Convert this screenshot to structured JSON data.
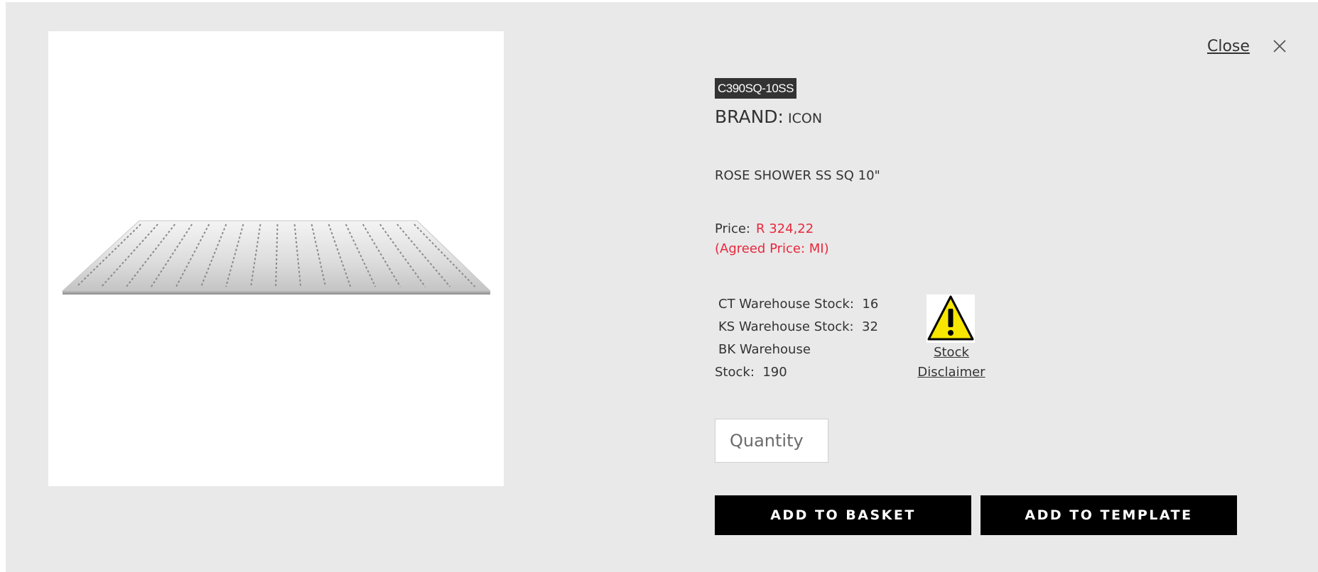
{
  "modal": {
    "close_label": "Close",
    "close_icon": "close-icon"
  },
  "product": {
    "image_alt": "shower-head-image",
    "sku": "C390SQ-10SS",
    "brand_label": "BRAND:",
    "brand_value": "ICON",
    "description": "ROSE SHOWER SS SQ 10\"",
    "price_label": "Price:",
    "price_value": "R 324,22",
    "agreed_price": "(Agreed Price: MI)",
    "stock": {
      "ct_label": "CT Warehouse Stock:",
      "ct_value": "16",
      "ks_label": "KS Warehouse Stock:",
      "ks_value": "32",
      "bk_label_line1": "BK Warehouse",
      "bk_label_line2": "Stock:",
      "bk_value": "190"
    },
    "disclaimer_line1": "Stock",
    "disclaimer_line2": "Disclaimer",
    "warning_icon": "warning-icon"
  },
  "form": {
    "quantity_placeholder": "Quantity",
    "quantity_value": ""
  },
  "actions": {
    "add_to_basket": "ADD TO BASKET",
    "add_to_template": "ADD TO TEMPLATE"
  },
  "colors": {
    "background": "#e9e9e9",
    "price_red": "#e8283c",
    "button_black": "#000000",
    "sku_badge": "#333333"
  }
}
